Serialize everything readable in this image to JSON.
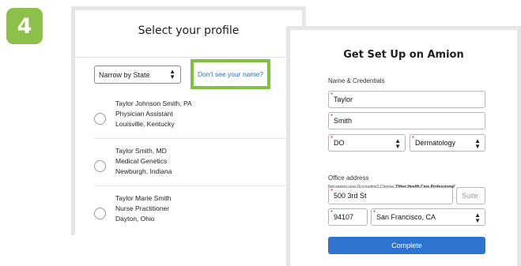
{
  "step": {
    "number": "4",
    "color": "#8cc04b"
  },
  "profile": {
    "title": "Select your profile",
    "state_select": {
      "value": "Narrow by State"
    },
    "name_link": {
      "label": "Don't see your name?",
      "highlight_color": "#7fc241"
    },
    "people": [
      {
        "name": "Taylor Johnson Smith, PA",
        "role": "Physician Assistant",
        "location": "Louisville, Kentucky"
      },
      {
        "name": "Taylor Smith, MD",
        "role": "Medical Genetics",
        "location": "Newburgh, Indiana"
      },
      {
        "name": "Taylor Marie Smith",
        "role": "Nurse Practitioner",
        "location": "Dayton, Ohio"
      }
    ]
  },
  "setup": {
    "title": "Get Set Up on Amion",
    "credentials_label": "Name & Credentials",
    "first_name": "Taylor",
    "last_name": "Smith",
    "credential": "DO",
    "occupation": "Dermatology",
    "note_prefix": "Not seeing your Occupation? Choose ",
    "note_option": "'Other Health Care Professional'",
    "office_label": "Office address",
    "street": "500 3rd St",
    "suite_placeholder": "Suite",
    "zip": "94107",
    "city": "San Francisco, CA",
    "complete_label": "Complete",
    "button_color": "#2d74d0",
    "required_color": "#d0312d"
  }
}
